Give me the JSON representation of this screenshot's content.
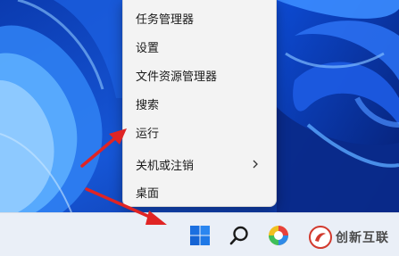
{
  "context_menu": {
    "items": [
      {
        "label": "任务管理器",
        "has_submenu": false
      },
      {
        "label": "设置",
        "has_submenu": false
      },
      {
        "label": "文件资源管理器",
        "has_submenu": false
      },
      {
        "label": "搜索",
        "has_submenu": false
      },
      {
        "label": "运行",
        "has_submenu": false
      },
      {
        "label": "关机或注销",
        "has_submenu": true
      },
      {
        "label": "桌面",
        "has_submenu": false
      }
    ]
  },
  "taskbar": {
    "buttons": [
      {
        "icon": "windows-start-icon"
      },
      {
        "icon": "search-icon"
      },
      {
        "icon": "color-app-icon"
      }
    ]
  },
  "watermark": {
    "text": "创新互联"
  },
  "colors": {
    "wallpaper_dark": "#0a3fb8",
    "wallpaper_light": "#4aa3ff",
    "arrow_red": "#e02424",
    "start_blue": "#1b6fe0"
  }
}
